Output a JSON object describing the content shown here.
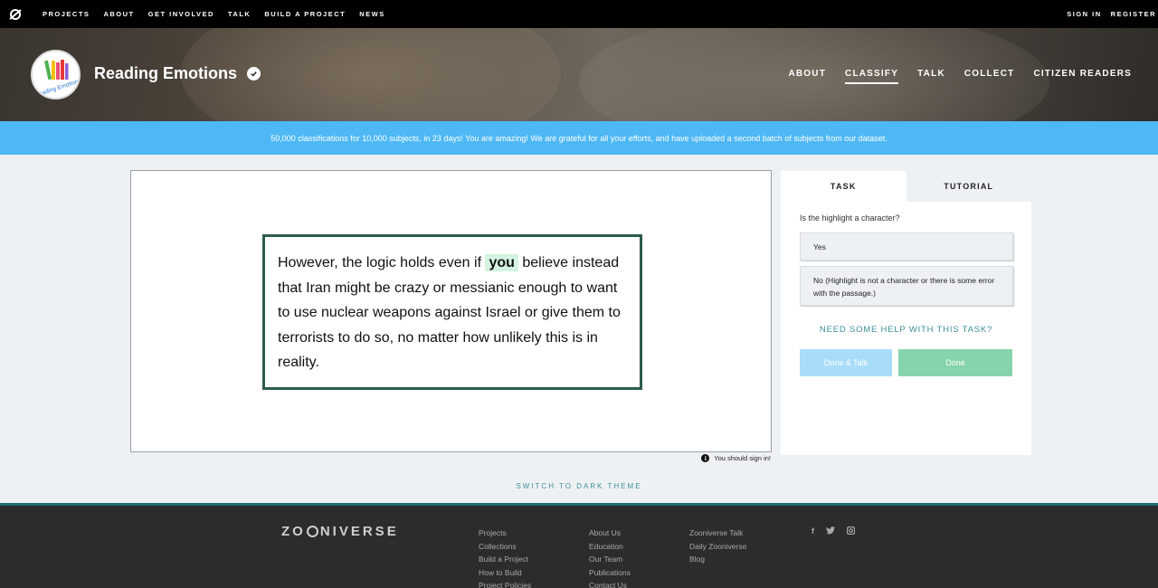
{
  "topnav": {
    "items": [
      "PROJECTS",
      "ABOUT",
      "GET INVOLVED",
      "TALK",
      "BUILD A PROJECT",
      "NEWS"
    ],
    "signin": "SIGN IN",
    "register": "REGISTER"
  },
  "project": {
    "logo_text": "Reading Emotions",
    "title": "Reading Emotions",
    "nav": [
      "ABOUT",
      "CLASSIFY",
      "TALK",
      "COLLECT",
      "CITIZEN READERS"
    ],
    "active_nav": "CLASSIFY"
  },
  "announcement": "50,000 classifications for 10,000 subjects, in 23 days! You are amazing! We are grateful for all your efforts, and have uploaded a second batch of subjects from our dataset.",
  "subject": {
    "before": "However, the logic holds even if ",
    "highlight": "you",
    "after": " believe instead that Iran might be crazy or messianic enough to want to use nuclear weapons against Israel or give them to terrorists to do so, no matter how unlikely this is in reality."
  },
  "signin_note": "You should sign in!",
  "task": {
    "tabs": [
      "TASK",
      "TUTORIAL"
    ],
    "question": "Is the highlight a character?",
    "answers": [
      "Yes",
      "No (Highlight is not a character or there is some error with the passage.)"
    ],
    "help": "NEED SOME HELP WITH THIS TASK?",
    "done_talk": "Done & Talk",
    "done": "Done"
  },
  "switch_theme": "SWITCH TO DARK THEME",
  "footer": {
    "brand_left": "ZO",
    "brand_right": "NIVERSE",
    "col1": [
      "Projects",
      "Collections",
      "Build a Project",
      "How to Build",
      "Project Policies"
    ],
    "col2": [
      "About Us",
      "Education",
      "Our Team",
      "Publications",
      "Contact Us"
    ],
    "col3": [
      "Zooniverse Talk",
      "Daily Zooniverse",
      "Blog"
    ],
    "social_icons": [
      "facebook-icon",
      "twitter-icon",
      "instagram-icon"
    ]
  },
  "colors": {
    "announcement_bg": "#4eb8f5",
    "passage_border": "#2e5c48",
    "highlight_bg": "#d4f3e0",
    "done_bg": "#86d4ab",
    "done_talk_bg": "#a9dcf9",
    "accent_teal": "#3f8f98"
  }
}
